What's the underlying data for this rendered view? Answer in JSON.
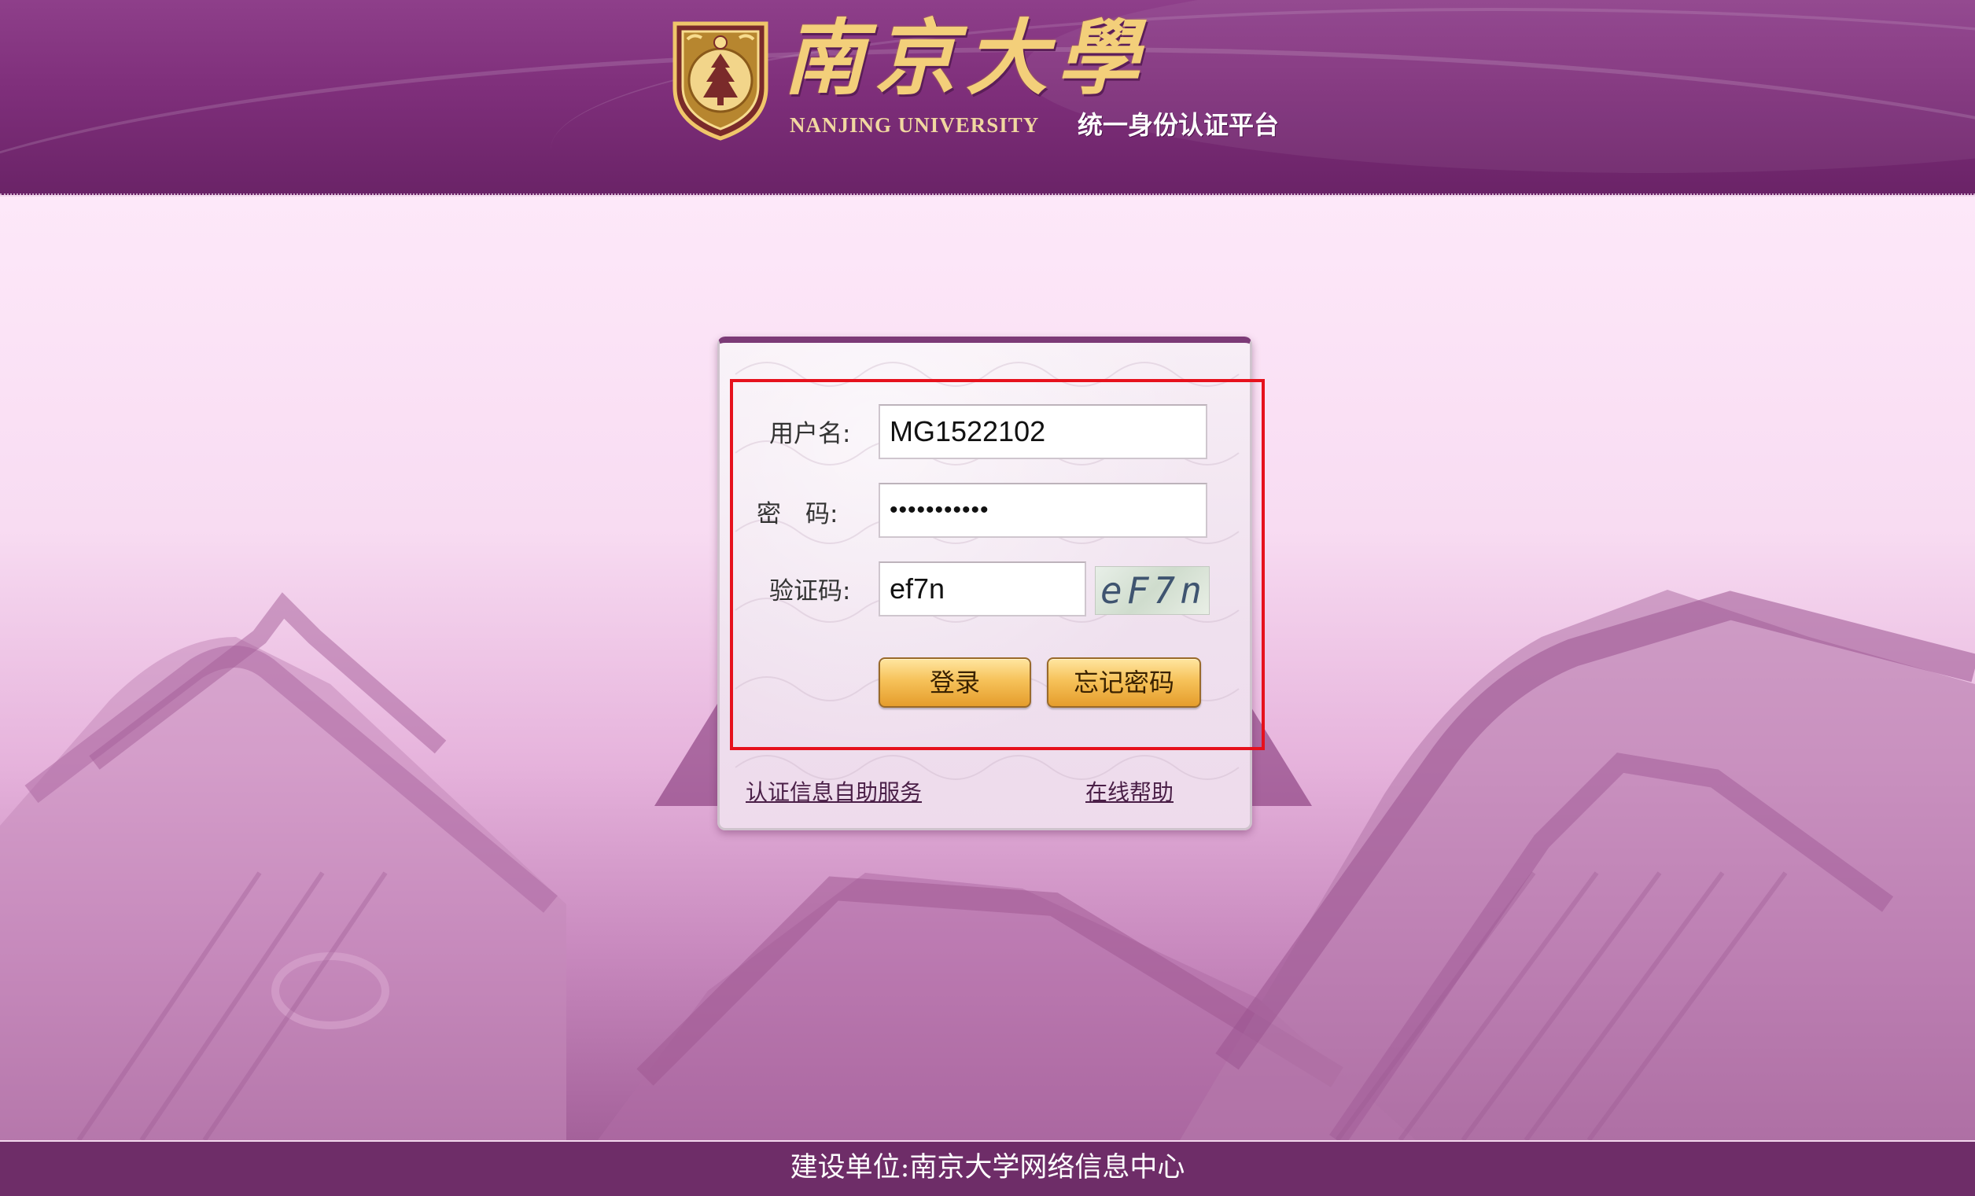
{
  "header": {
    "brand_cn": "南京大學",
    "brand_en": "NANJING UNIVERSITY",
    "platform_title": "统一身份认证平台",
    "emblem_text": "NANJING UNIVERSITY"
  },
  "login": {
    "username_label": "用户名:",
    "password_label": "密　码:",
    "captcha_label": "验证码:",
    "username_value": "MG1522102",
    "password_value": "•••••••••••",
    "captcha_value": "ef7n",
    "captcha_image_text": "eF7n",
    "login_button": "登录",
    "forgot_button": "忘记密码",
    "self_service_link": "认证信息自助服务",
    "help_link": "在线帮助"
  },
  "footer": {
    "text": "建设单位:南京大学网络信息中心"
  },
  "colors": {
    "header": "#7f2f7b",
    "footer": "#6e2d68",
    "highlight": "#e6111d",
    "button": "#f6c25a",
    "brand_gold": "#f3cf7a"
  },
  "icons": {
    "emblem": "university-emblem-icon"
  }
}
